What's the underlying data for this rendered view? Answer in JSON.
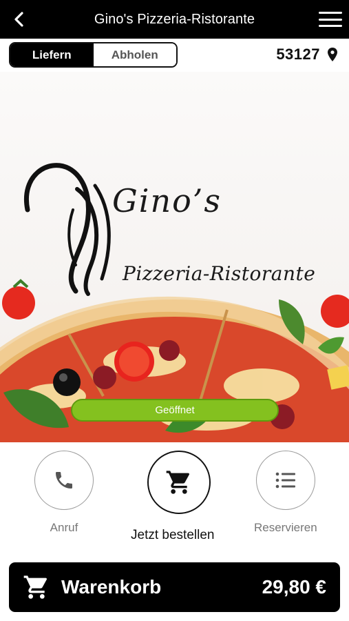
{
  "header": {
    "title": "Gino's Pizzeria-Ristorante",
    "back_icon": "chevron-left-icon",
    "menu_icon": "hamburger-menu-icon"
  },
  "mode": {
    "options": [
      "Liefern",
      "Abholen"
    ],
    "selected": "Liefern"
  },
  "location": {
    "zip": "53127",
    "icon": "map-pin-icon"
  },
  "hero": {
    "brand_name": "Gino’s",
    "brand_subtitle": "Pizzeria-Ristorante",
    "status": "Geöffnet",
    "status_color": "#84c11f"
  },
  "actions": [
    {
      "label": "Anruf",
      "icon": "phone-icon"
    },
    {
      "label": "Jetzt bestellen",
      "icon": "cart-icon"
    },
    {
      "label": "Reservieren",
      "icon": "list-icon"
    }
  ],
  "cart": {
    "label": "Warenkorb",
    "total": "29,80 €",
    "icon": "cart-icon"
  }
}
